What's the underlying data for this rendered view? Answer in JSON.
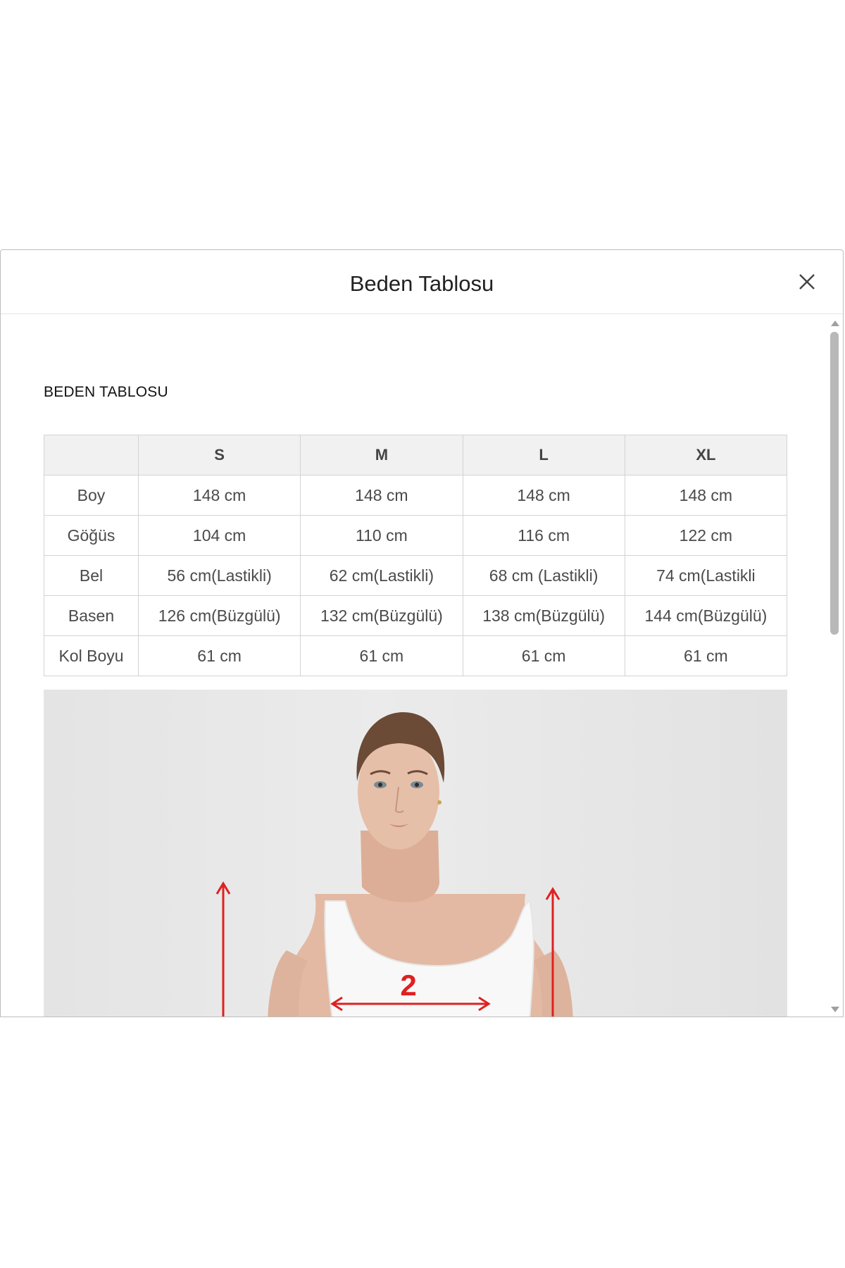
{
  "modal": {
    "title": "Beden Tablosu",
    "close_icon": "close-icon"
  },
  "content": {
    "section_title": "BEDEN TABLOSU",
    "table": {
      "headers": [
        "",
        "S",
        "M",
        "L",
        "XL"
      ],
      "rows": [
        {
          "label": "Boy",
          "values": [
            "148 cm",
            "148 cm",
            "148 cm",
            "148 cm"
          ]
        },
        {
          "label": "Göğüs",
          "values": [
            "104 cm",
            "110 cm",
            "116 cm",
            "122 cm"
          ]
        },
        {
          "label": "Bel",
          "values": [
            "56 cm(Lastikli)",
            "62 cm(Lastikli)",
            "68 cm (Lastikli)",
            "74 cm(Lastikli"
          ]
        },
        {
          "label": "Basen",
          "values": [
            "126 cm(Büzgülü)",
            "132 cm(Büzgülü)",
            "138 cm(Büzgülü)",
            "144 cm(Büzgülü)"
          ]
        },
        {
          "label": "Kol Boyu",
          "values": [
            "61 cm",
            "61 cm",
            "61 cm",
            "61 cm"
          ]
        }
      ]
    },
    "measurement_image": {
      "marker_label": "2",
      "accent_color": "#e02020"
    }
  }
}
